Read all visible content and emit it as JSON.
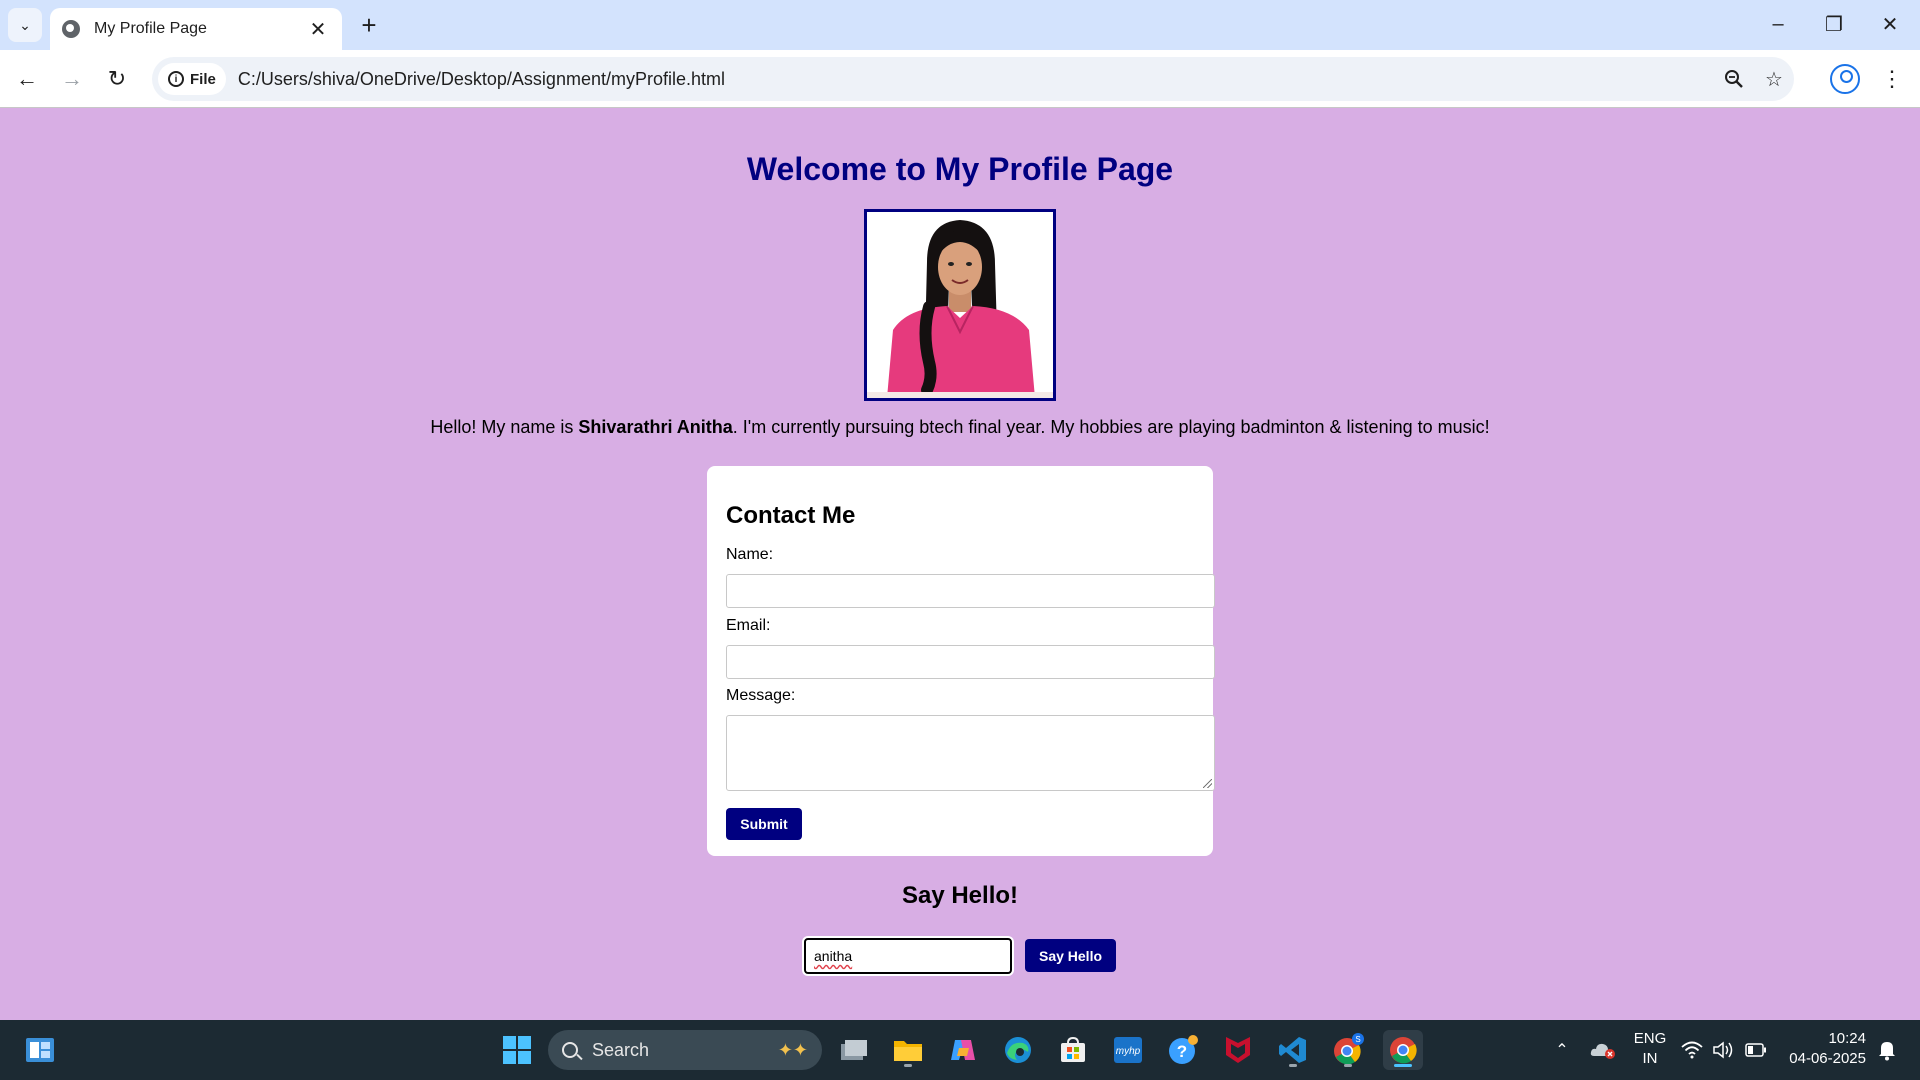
{
  "browser": {
    "tab_title": "My Profile Page",
    "site_chip": "File",
    "url": "C:/Users/shiva/OneDrive/Desktop/Assignment/myProfile.html"
  },
  "page": {
    "title": "Welcome to My Profile Page",
    "intro": {
      "before": "Hello! My name is ",
      "name": "Shivarathri Anitha",
      "after": ". I'm currently pursuing btech final year. My hobbies are playing badminton & listening to music!"
    },
    "contact": {
      "title": "Contact Me",
      "name_label": "Name:",
      "name_value": "",
      "email_label": "Email:",
      "email_value": "",
      "message_label": "Message:",
      "message_value": "",
      "submit_label": "Submit"
    },
    "hello": {
      "title": "Say Hello!",
      "input_value": "anitha",
      "button_label": "Say Hello"
    }
  },
  "taskbar": {
    "search_placeholder": "Search",
    "language": "ENG",
    "region": "IN",
    "time": "10:24",
    "date": "04-06-2025"
  },
  "colors": {
    "page_bg": "#d8aee4",
    "accent_navy": "#000080",
    "tabbar_bg": "#d3e3fd",
    "taskbar_bg": "#1c2a33"
  }
}
